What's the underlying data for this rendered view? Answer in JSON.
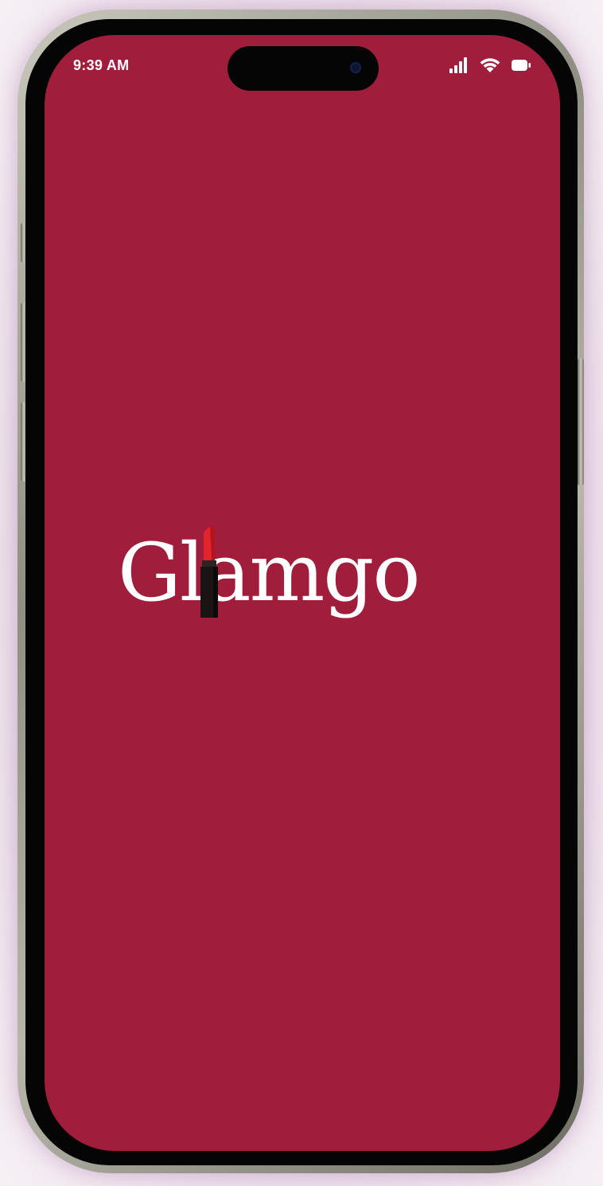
{
  "status_bar": {
    "time": "9:39 AM",
    "icons": [
      "cellular-signal-icon",
      "wifi-icon",
      "battery-icon"
    ]
  },
  "splash": {
    "logo_text": "Glamgo",
    "logo_icon": "lipstick-icon"
  },
  "colors": {
    "screen_background": "#a01e3c",
    "logo_text": "#ffffff",
    "lipstick_bullet": "#e3242b",
    "lipstick_tube": "#1a1414"
  }
}
